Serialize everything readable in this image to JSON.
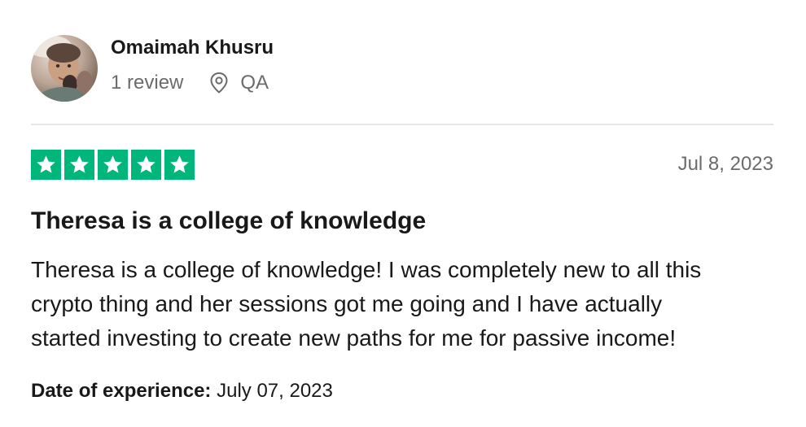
{
  "reviewer": {
    "name": "Omaimah Khusru",
    "review_count": "1 review",
    "location": "QA"
  },
  "review": {
    "rating": 5,
    "rating_max": 5,
    "date": "Jul 8, 2023",
    "title": "Theresa is a college of knowledge",
    "body_lines": [
      "Theresa is a college of knowledge! I was completely new to all this",
      "crypto thing and her sessions got me going and I have actually",
      "started investing to create new paths for me for passive income!"
    ],
    "experience_label": "Date of experience:",
    "experience_date": "July 07, 2023"
  },
  "colors": {
    "star_fill": "#00b67a",
    "muted_text": "#6b6b6b",
    "primary_text": "#191919",
    "divider": "#e5e5e5"
  },
  "icons": {
    "location": "map-pin-icon",
    "rating": "star-icon"
  }
}
